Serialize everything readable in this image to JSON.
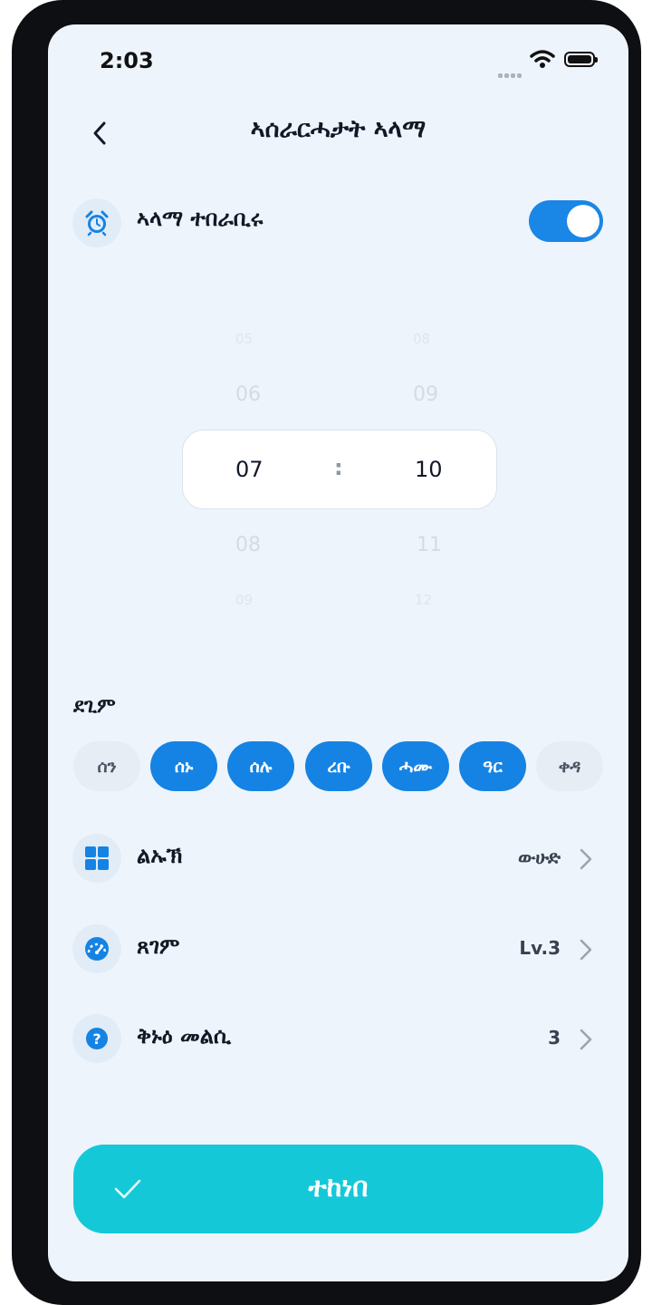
{
  "status": {
    "time": "2:03"
  },
  "header": {
    "title": "ኣሰራርሓታት ኣላማ"
  },
  "alarm_toggle": {
    "label": "ኣላማ ተበራቢሩ",
    "on": true
  },
  "time_picker": {
    "hours": [
      "05",
      "06",
      "07",
      "08",
      "09"
    ],
    "minutes": [
      "08",
      "09",
      "10",
      "11",
      "12"
    ],
    "selected_hour": "07",
    "selected_minute": "10",
    "separator": ":"
  },
  "repeat": {
    "label": "ደጊም",
    "days": [
      {
        "label": "ሰን",
        "on": false
      },
      {
        "label": "ሰኑ",
        "on": true
      },
      {
        "label": "ሰሉ",
        "on": true
      },
      {
        "label": "ረቡ",
        "on": true
      },
      {
        "label": "ሓሙ",
        "on": true
      },
      {
        "label": "ዓር",
        "on": true
      },
      {
        "label": "ቀዳ",
        "on": false
      }
    ]
  },
  "settings": [
    {
      "label": "ልኡኽ",
      "value": "ውሁድ",
      "icon": "grid-icon"
    },
    {
      "label": "ጸገም",
      "value": "Lv.3",
      "icon": "speedometer-icon"
    },
    {
      "label": "ቅኑዕ መልሲ",
      "value": "3",
      "icon": "question-icon"
    }
  ],
  "confirm_button": {
    "label": "ተከነበ"
  },
  "colors": {
    "accent": "#1583e3",
    "confirm": "#15c8d8",
    "background": "#eef4fb"
  }
}
